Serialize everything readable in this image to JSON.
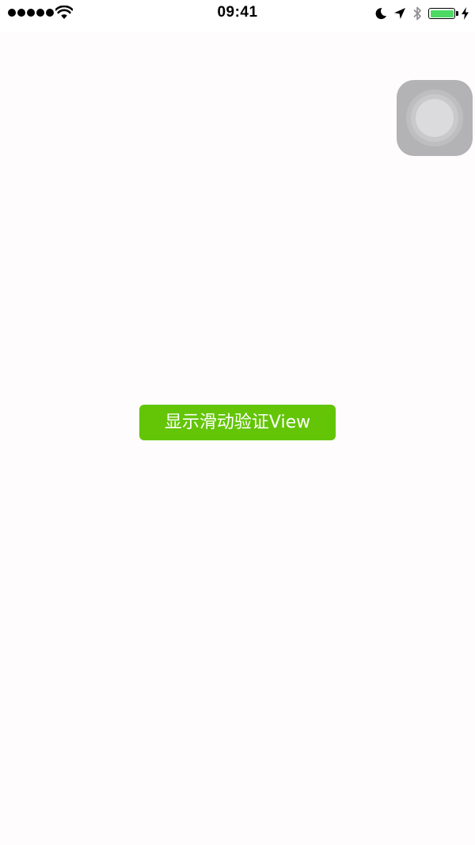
{
  "status_bar": {
    "time": "09:41",
    "signal_dots": 5,
    "icons": [
      "signal-dots-icon",
      "wifi-icon",
      "moon-icon",
      "location-arrow-icon",
      "bluetooth-icon",
      "battery-icon",
      "charging-bolt-icon"
    ],
    "battery_level": 1.0,
    "battery_color": "#4cd964"
  },
  "assistive_touch": {
    "icon": "assistive-touch-icon",
    "color": "#b3b2b4"
  },
  "main": {
    "show_button_label": "显示滑动验证View",
    "show_button_color": "#63c506"
  }
}
